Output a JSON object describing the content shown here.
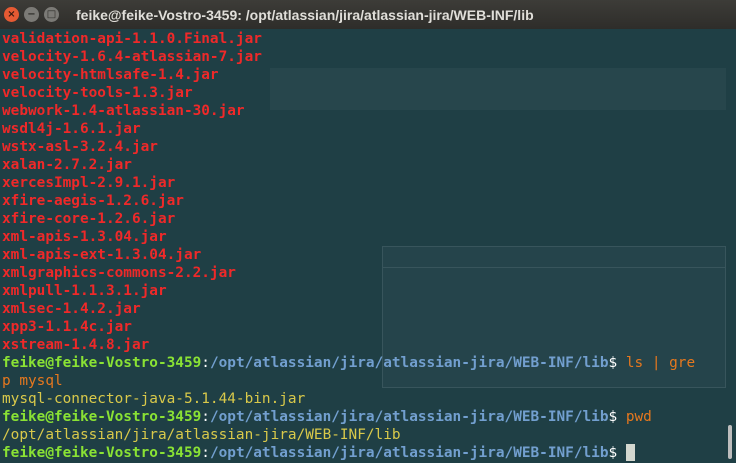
{
  "window": {
    "title": "feike@feike-Vostro-3459: /opt/atlassian/jira/atlassian-jira/WEB-INF/lib",
    "close_glyph": "×",
    "minimize_glyph": "−",
    "maximize_glyph": "□"
  },
  "terminal": {
    "files": [
      "validation-api-1.1.0.Final.jar",
      "velocity-1.6.4-atlassian-7.jar",
      "velocity-htmlsafe-1.4.jar",
      "velocity-tools-1.3.jar",
      "webwork-1.4-atlassian-30.jar",
      "wsdl4j-1.6.1.jar",
      "wstx-asl-3.2.4.jar",
      "xalan-2.7.2.jar",
      "xercesImpl-2.9.1.jar",
      "xfire-aegis-1.2.6.jar",
      "xfire-core-1.2.6.jar",
      "xml-apis-1.3.04.jar",
      "xml-apis-ext-1.3.04.jar",
      "xmlgraphics-commons-2.2.jar",
      "xmlpull-1.1.3.1.jar",
      "xmlsec-1.4.2.jar",
      "xpp3-1.1.4c.jar",
      "xstream-1.4.8.jar"
    ],
    "prompt_user": "feike@feike-Vostro-3459",
    "prompt_sep": ":",
    "prompt_path": "/opt/atlassian/jira/atlassian-jira/WEB-INF/lib",
    "prompt_end": "$ ",
    "cmd1_part1": "ls | gre",
    "cmd1_part2": "p mysql",
    "grep_output": "mysql-connector-java-5.1.44-bin.jar",
    "cmd2": "pwd",
    "pwd_output": "/opt/atlassian/jira/atlassian-jira/WEB-INF/lib"
  },
  "colors": {
    "background": "#1f3f45",
    "filename": "#ef2929",
    "prompt_user": "#8ae234",
    "prompt_path": "#729fcf",
    "command": "#e6781e"
  }
}
